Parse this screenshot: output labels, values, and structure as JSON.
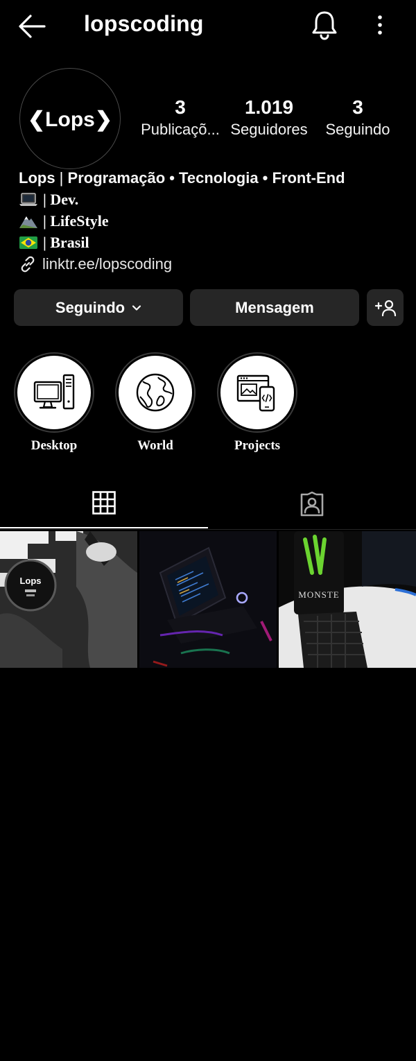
{
  "header": {
    "username": "lopscoding"
  },
  "profile": {
    "avatar_text": "❮Lops❯",
    "stats": {
      "posts": {
        "value": "3",
        "label": "Publicaçõ..."
      },
      "followers": {
        "value": "1.019",
        "label": "Seguidores"
      },
      "following": {
        "value": "3",
        "label": "Seguindo"
      }
    }
  },
  "bio": {
    "name": "Lops",
    "separator": " | ",
    "categories": "Programação • Tecnologia • Front-End",
    "lines": [
      {
        "icon": "laptop-emoji",
        "text": "| Dev."
      },
      {
        "icon": "mountain-emoji",
        "text": "| LifeStyle"
      },
      {
        "icon": "brazil-flag-emoji",
        "text": "| Brasil"
      }
    ],
    "link": "linktr.ee/lopscoding"
  },
  "actions": {
    "following_label": "Seguindo",
    "message_label": "Mensagem"
  },
  "highlights": [
    {
      "label": "Desktop",
      "icon": "desktop-computer-icon"
    },
    {
      "label": "World",
      "icon": "globe-icon"
    },
    {
      "label": "Projects",
      "icon": "code-devices-icon"
    }
  ],
  "post1": {
    "logo_text": "Lops"
  },
  "post3": {
    "can_text": "MONSTE"
  },
  "colors": {
    "background": "#000000",
    "button": "#262626",
    "monster_green": "#6bd430"
  }
}
